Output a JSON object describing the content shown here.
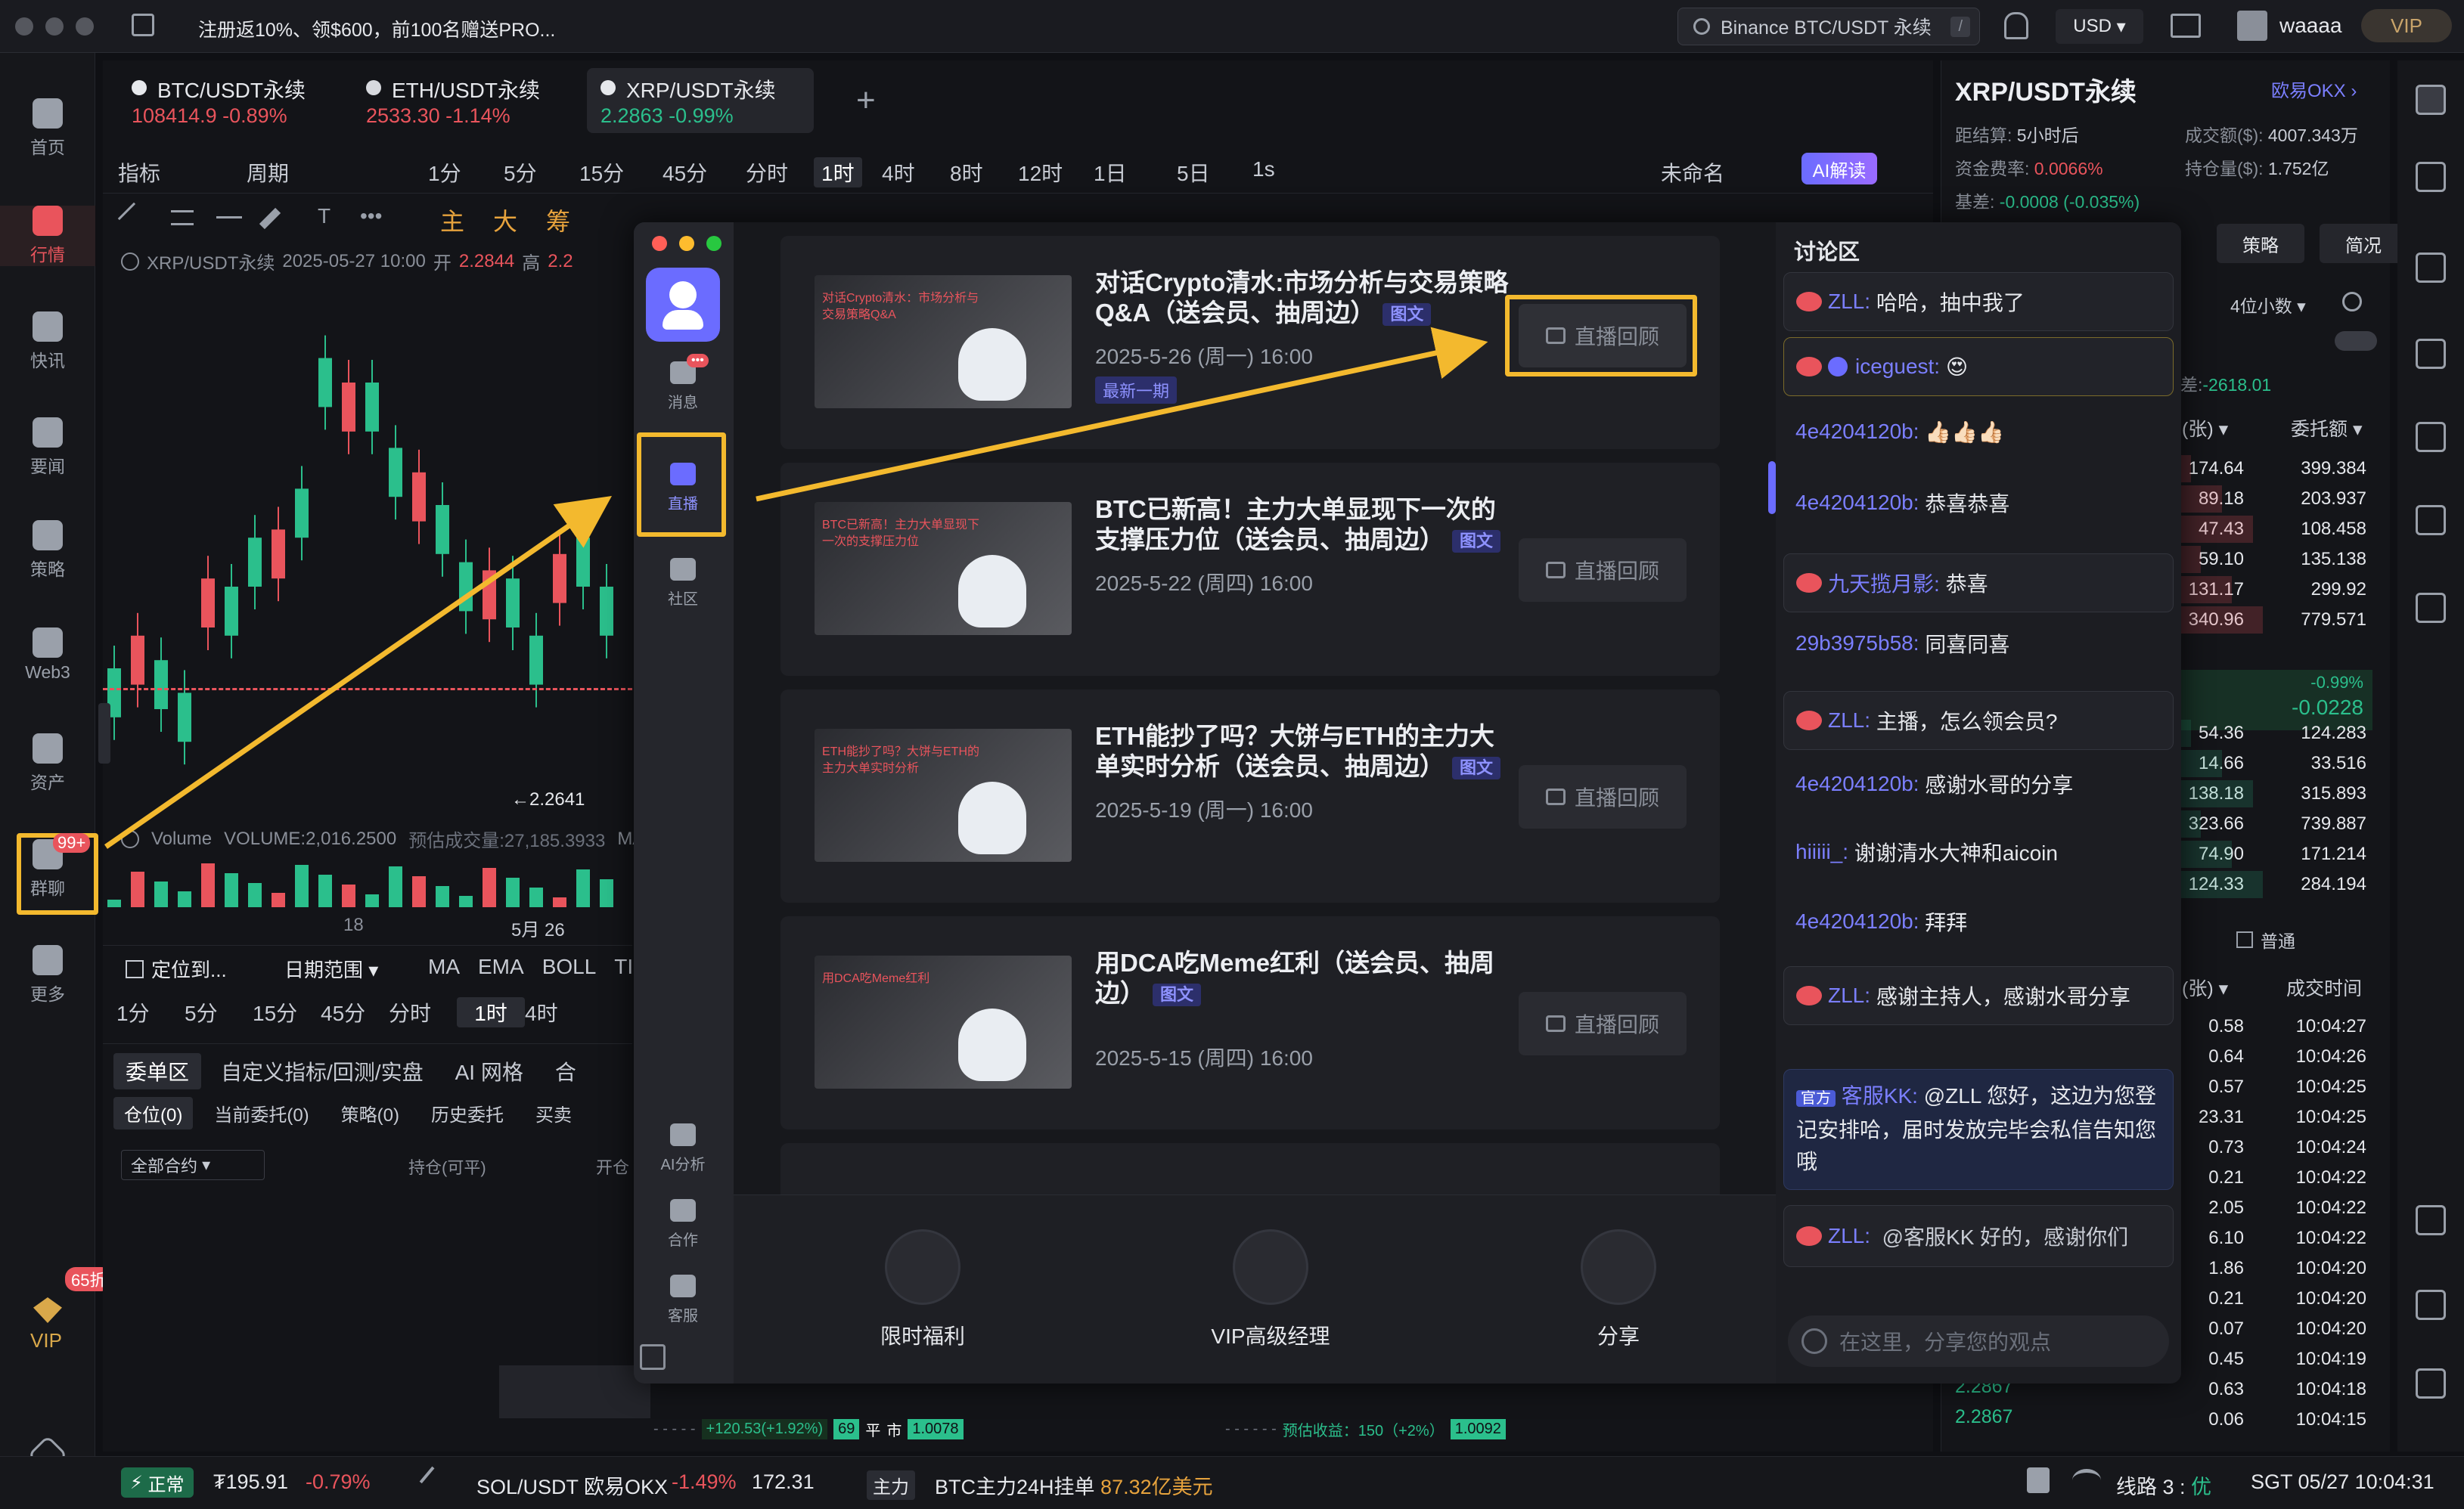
{
  "titlebar": {
    "promo": "注册返10%、领$600，前100名赠送PRO...",
    "search": "Binance BTC/USDT 永续",
    "search_key": "/",
    "currency": "USD",
    "user": "waaaa",
    "vip": "VIP"
  },
  "nav": [
    {
      "label": "首页",
      "icon": "home-icon"
    },
    {
      "label": "行情",
      "icon": "market-icon"
    },
    {
      "label": "快讯",
      "icon": "news-flash-icon"
    },
    {
      "label": "要闻",
      "icon": "headline-icon"
    },
    {
      "label": "策略",
      "icon": "strategy-icon"
    },
    {
      "label": "Web3",
      "icon": "web3-icon"
    },
    {
      "label": "资产",
      "icon": "wallet-icon"
    },
    {
      "label": "群聊",
      "icon": "group-chat-icon",
      "badge": "99+"
    },
    {
      "label": "更多",
      "icon": "more-icon"
    }
  ],
  "vip_badge": "65折",
  "vip_label": "VIP",
  "tabs": [
    {
      "name": "BTC/USDT永续",
      "price": "108414.9",
      "chg": "-0.89%"
    },
    {
      "name": "ETH/USDT永续",
      "price": "2533.30",
      "chg": "-1.14%"
    },
    {
      "name": "XRP/USDT永续",
      "price": "2.2863",
      "chg": "-0.99%"
    }
  ],
  "toolbar": [
    "指标",
    "周期",
    "1分",
    "5分",
    "15分",
    "45分",
    "分时",
    "1时",
    "4时",
    "8时",
    "12时",
    "1日",
    "5日",
    "1s",
    "未命名",
    "AI解读"
  ],
  "drawbar": [
    "主",
    "大",
    "筹"
  ],
  "chart_info": {
    "label": "XRP/USDT永续",
    "time": "2025-05-27 10:00",
    "open_l": "开",
    "open": "2.2844",
    "high_l": "高",
    "high": "2.2"
  },
  "chart_low": "←2.2641",
  "volume": {
    "label": "Volume",
    "vol": "VOLUME:2,016.2500",
    "pred": "预估成交量:27,185.3933",
    "ma": "MA"
  },
  "xaxis": [
    "18",
    "5月 26"
  ],
  "chart_candles": [
    [
      0,
      20
    ],
    [
      1,
      18
    ],
    [
      1,
      21
    ],
    [
      1,
      17
    ],
    [
      2,
      25
    ],
    [
      2,
      30
    ],
    [
      3,
      36
    ],
    [
      3,
      31
    ],
    [
      4,
      42
    ],
    [
      5,
      58
    ],
    [
      5,
      49
    ],
    [
      6,
      55
    ],
    [
      6,
      47
    ],
    [
      6,
      38
    ],
    [
      7,
      40
    ],
    [
      7,
      33
    ],
    [
      8,
      26
    ],
    [
      8,
      31
    ],
    [
      8,
      24
    ],
    [
      9,
      28
    ],
    [
      10,
      36
    ],
    [
      11,
      30
    ]
  ],
  "lower_bar": {
    "locate": "定位到...",
    "range": "日期范围",
    "inds": [
      "MA",
      "EMA",
      "BOLL",
      "TI"
    ],
    "periods": [
      "1分",
      "5分",
      "15分",
      "45分",
      "分时",
      "1时",
      "4时"
    ]
  },
  "bottom_tabs": [
    "委单区",
    "自定义指标/回测/实盘",
    "AI 网格",
    "合"
  ],
  "order_tabs": [
    "仓位(0)",
    "当前委托(0)",
    "策略(0)",
    "历史委托",
    "买卖"
  ],
  "order_cols": {
    "all": "全部合约",
    "hold": "持仓(可平)",
    "open": "开仓"
  },
  "right": {
    "title": "XRP/USDT永续",
    "exch": "欧易OKX",
    "settle_l": "距结算:",
    "settle": "5小时后",
    "vol_l": "成交额($):",
    "vol": "4007.343万",
    "fund_l": "资金费率:",
    "fund": "0.0066%",
    "oi_l": "持仓量($):",
    "oi": "1.752亿",
    "basis_l": "基差:",
    "basis": "-0.0008 (-0.035%)",
    "tabs": [
      "策略",
      "简况"
    ],
    "decimals": "4位小数",
    "spread_l": "差:",
    "spread": "-2618.01",
    "cols": [
      "(张)",
      "委托额"
    ],
    "mid_pct": "-0.99%",
    "mid_chg": "-0.0228",
    "normal": "普通",
    "trade_cols": [
      "(张)",
      "成交时间"
    ]
  },
  "asks": [
    [
      "174.64",
      "399.384"
    ],
    [
      "89.18",
      "203.937"
    ],
    [
      "47.43",
      "108.458"
    ],
    [
      "59.10",
      "135.138"
    ],
    [
      "131.17",
      "299.92"
    ],
    [
      "340.96",
      "779.571"
    ]
  ],
  "bids": [
    [
      "54.36",
      "124.283"
    ],
    [
      "14.66",
      "33.516"
    ],
    [
      "138.18",
      "315.893"
    ],
    [
      "323.66",
      "739.887"
    ],
    [
      "74.90",
      "171.214"
    ],
    [
      "124.33",
      "284.194"
    ]
  ],
  "trades": [
    [
      "0.58",
      "10:04:27"
    ],
    [
      "0.64",
      "10:04:26"
    ],
    [
      "0.57",
      "10:04:25"
    ],
    [
      "23.31",
      "10:04:25"
    ],
    [
      "0.73",
      "10:04:24"
    ],
    [
      "0.21",
      "10:04:22"
    ],
    [
      "2.05",
      "10:04:22"
    ],
    [
      "6.10",
      "10:04:22"
    ],
    [
      "1.86",
      "10:04:20"
    ],
    [
      "0.21",
      "10:04:20"
    ],
    [
      "0.07",
      "10:04:20"
    ],
    [
      "0.45",
      "10:04:19"
    ],
    [
      "0.63",
      "10:04:18"
    ],
    [
      "0.06",
      "10:04:15"
    ]
  ],
  "trade_prices": [
    "2.2867",
    "2.2867"
  ],
  "live": {
    "side": [
      {
        "label": "消息",
        "icon": "message-icon",
        "badge": "•••"
      },
      {
        "label": "直播",
        "icon": "live-icon"
      },
      {
        "label": "社区",
        "icon": "community-icon"
      },
      {
        "label": "AI分析",
        "icon": "ai-analysis-icon"
      },
      {
        "label": "合作",
        "icon": "cooperation-icon"
      },
      {
        "label": "客服",
        "icon": "customer-service-icon"
      }
    ],
    "cards": [
      {
        "title": "对话Crypto清水:市场分析与交易策略Q&A（送会员、抽周边）",
        "tag": "图文",
        "date": "2025-5-26 (周一) 16:00",
        "latest": "最新一期",
        "thumb": "对话Crypto清水：市场分析与交易策略Q&A"
      },
      {
        "title": "BTC已新高！主力大单显现下一次的支撑压力位（送会员、抽周边）",
        "tag": "图文",
        "date": "2025-5-22 (周四) 16:00",
        "thumb": "BTC已新高！主力大单显现下一次的支撑压力位"
      },
      {
        "title": "ETH能抄了吗？大饼与ETH的主力大单实时分析（送会员、抽周边）",
        "tag": "图文",
        "date": "2025-5-19 (周一) 16:00",
        "thumb": "ETH能抄了吗？大饼与ETH的主力大单实时分析"
      },
      {
        "title": "用DCA吃Meme红利（送会员、抽周边）",
        "tag": "图文",
        "date": "2025-5-15 (周四) 16:00",
        "thumb": "用DCA吃Meme红利"
      }
    ],
    "replay": "直播回顾",
    "actions": [
      {
        "label": "限时福利",
        "icon": "vip-gift-icon"
      },
      {
        "label": "VIP高级经理",
        "icon": "vip-manager-icon"
      },
      {
        "label": "分享",
        "icon": "share-icon"
      }
    ]
  },
  "chat": {
    "title": "讨论区",
    "msgs": [
      {
        "nick": "ZLL:",
        "text": "哈哈，抽中我了",
        "box": true
      },
      {
        "nick": "iceguest:",
        "text": "😍",
        "box": true
      },
      {
        "nick": "4e4204120b:",
        "text": "👍🏻👍🏻👍🏻"
      },
      {
        "nick": "4e4204120b:",
        "text": "恭喜恭喜"
      },
      {
        "nick": "九天揽月影:",
        "text": "恭喜",
        "box": true
      },
      {
        "nick": "29b3975b58:",
        "text": "同喜同喜"
      },
      {
        "nick": "ZLL:",
        "text": "主播，怎么领会员?",
        "box": true
      },
      {
        "nick": "4e4204120b:",
        "text": "感谢水哥的分享"
      },
      {
        "nick": "hiiiii_:",
        "text": "谢谢清水大神和aicoin"
      },
      {
        "nick": "4e4204120b:",
        "text": "拜拜"
      },
      {
        "nick": "ZLL:",
        "text": "感谢主持人，感谢水哥分享",
        "box": true
      }
    ],
    "official": {
      "tag": "官方",
      "nick": "客服KK:",
      "text": "@ZLL 您好，这边为您登记安排哈，届时发放完毕会私信告知您哦"
    },
    "last": {
      "nick": "ZLL:",
      "text": "@客服KK 好的，感谢你们"
    },
    "input_placeholder": "在这里，分享您的观点"
  },
  "bottom_strip": {
    "l1": "+120.53(+1.92%)",
    "l2": "69",
    "l3": "平",
    "l4": "市",
    "l5": "1.0078",
    "r1": "预估收益：150（+2%）",
    "r2": "1.0092"
  },
  "status": {
    "mode": "正常",
    "price": "₮195.91",
    "chg": "-0.79%",
    "pair": "SOL/USDT 欧易OKX",
    "pchg": "-1.49%",
    "pval": "172.31",
    "tag": "主力",
    "btc": "BTC主力24H挂单",
    "btcv": "87.32亿美元",
    "line": "线路 3 :",
    "line_q": "优",
    "time": "SGT 05/27 10:04:31"
  }
}
